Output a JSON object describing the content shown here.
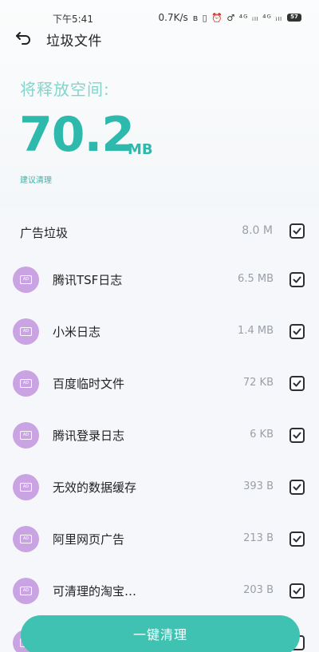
{
  "status_bar": {
    "time": "下午5:41",
    "speed": "0.7K/s",
    "icons": "ʙ ▯ ⏰ ♂ ⁴ᴳ ᵢₗₗ ⁴ᴳ ᵢₗₗ",
    "battery": "57"
  },
  "header": {
    "title": "垃圾文件"
  },
  "summary": {
    "release_label": "将释放空间:",
    "size_value": "70.2",
    "size_unit": "MB",
    "suggestion": "建议清理"
  },
  "category": {
    "label": "广告垃圾",
    "size": "8.0 M",
    "checked": true
  },
  "items": [
    {
      "label": "腾讯TSF日志",
      "size": "6.5 MB",
      "checked": true
    },
    {
      "label": "小米日志",
      "size": "1.4 MB",
      "checked": true
    },
    {
      "label": "百度临时文件",
      "size": "72 KB",
      "checked": true
    },
    {
      "label": "腾讯登录日志",
      "size": "6 KB",
      "checked": true
    },
    {
      "label": "无效的数据缓存",
      "size": "393 B",
      "checked": true
    },
    {
      "label": "阿里网页广告",
      "size": "213 B",
      "checked": true
    },
    {
      "label": "可清理的淘宝…",
      "size": "203 B",
      "checked": true
    }
  ],
  "actions": {
    "clean_button": "一键清理"
  },
  "colors": {
    "accent": "#2db9ab",
    "button": "#3fc2b2",
    "icon_bg": "#caa3e2"
  }
}
